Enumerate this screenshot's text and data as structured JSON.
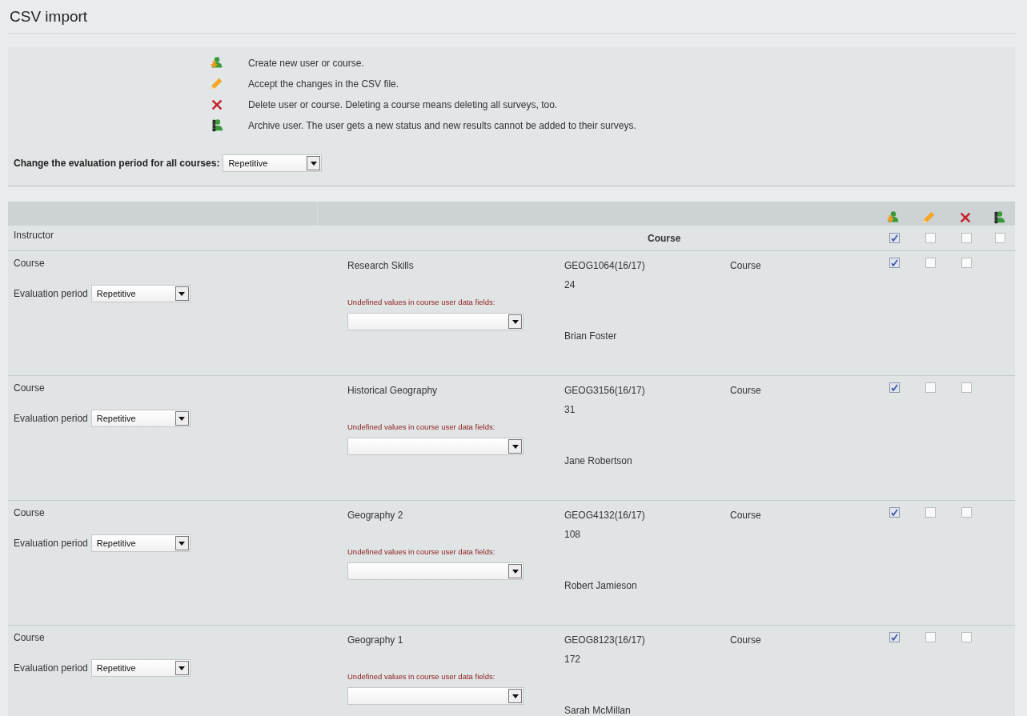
{
  "title": "CSV import",
  "legend": [
    {
      "kind": "create",
      "text": "Create new user or course."
    },
    {
      "kind": "accept",
      "text": "Accept the changes in the CSV file."
    },
    {
      "kind": "delete",
      "text": "Delete user or course. Deleting a course means deleting all surveys, too."
    },
    {
      "kind": "archive",
      "text": "Archive user. The user gets a new status and new results cannot be added to their surveys."
    }
  ],
  "period_all": {
    "label": "Change the evaluation period for all courses:",
    "value": "Repetitive"
  },
  "table": {
    "header_icons": [
      {
        "kind": "create"
      },
      {
        "kind": "accept"
      },
      {
        "kind": "delete"
      },
      {
        "kind": "archive"
      }
    ],
    "instructor_row": {
      "label": "Instructor",
      "course_heading": "Course",
      "checks": [
        true,
        false,
        false,
        false
      ]
    },
    "rows": [
      {
        "type_label": "Course",
        "period_label": "Evaluation period",
        "period_value": "Repetitive",
        "name": "Research Skills",
        "undefined_label": "Undefined values in course user data fields:",
        "code": "GEOG1064(16/17)",
        "count": "24",
        "type": "Course",
        "instructor": "Brian Foster",
        "checks": [
          true,
          false,
          false
        ]
      },
      {
        "type_label": "Course",
        "period_label": "Evaluation period",
        "period_value": "Repetitive",
        "name": "Historical Geography",
        "undefined_label": "Undefined values in course user data fields:",
        "code": "GEOG3156(16/17)",
        "count": "31",
        "type": "Course",
        "instructor": "Jane Robertson",
        "checks": [
          true,
          false,
          false
        ]
      },
      {
        "type_label": "Course",
        "period_label": "Evaluation period",
        "period_value": "Repetitive",
        "name": "Geography 2",
        "undefined_label": "Undefined values in course user data fields:",
        "code": "GEOG4132(16/17)",
        "count": "108",
        "type": "Course",
        "instructor": "Robert Jamieson",
        "checks": [
          true,
          false,
          false
        ]
      },
      {
        "type_label": "Course",
        "period_label": "Evaluation period",
        "period_value": "Repetitive",
        "name": "Geography 1",
        "undefined_label": "Undefined values in course user data fields:",
        "code": "GEOG8123(16/17)",
        "count": "172",
        "type": "Course",
        "instructor": "Sarah McMillan",
        "checks": [
          true,
          false,
          false
        ]
      }
    ]
  }
}
